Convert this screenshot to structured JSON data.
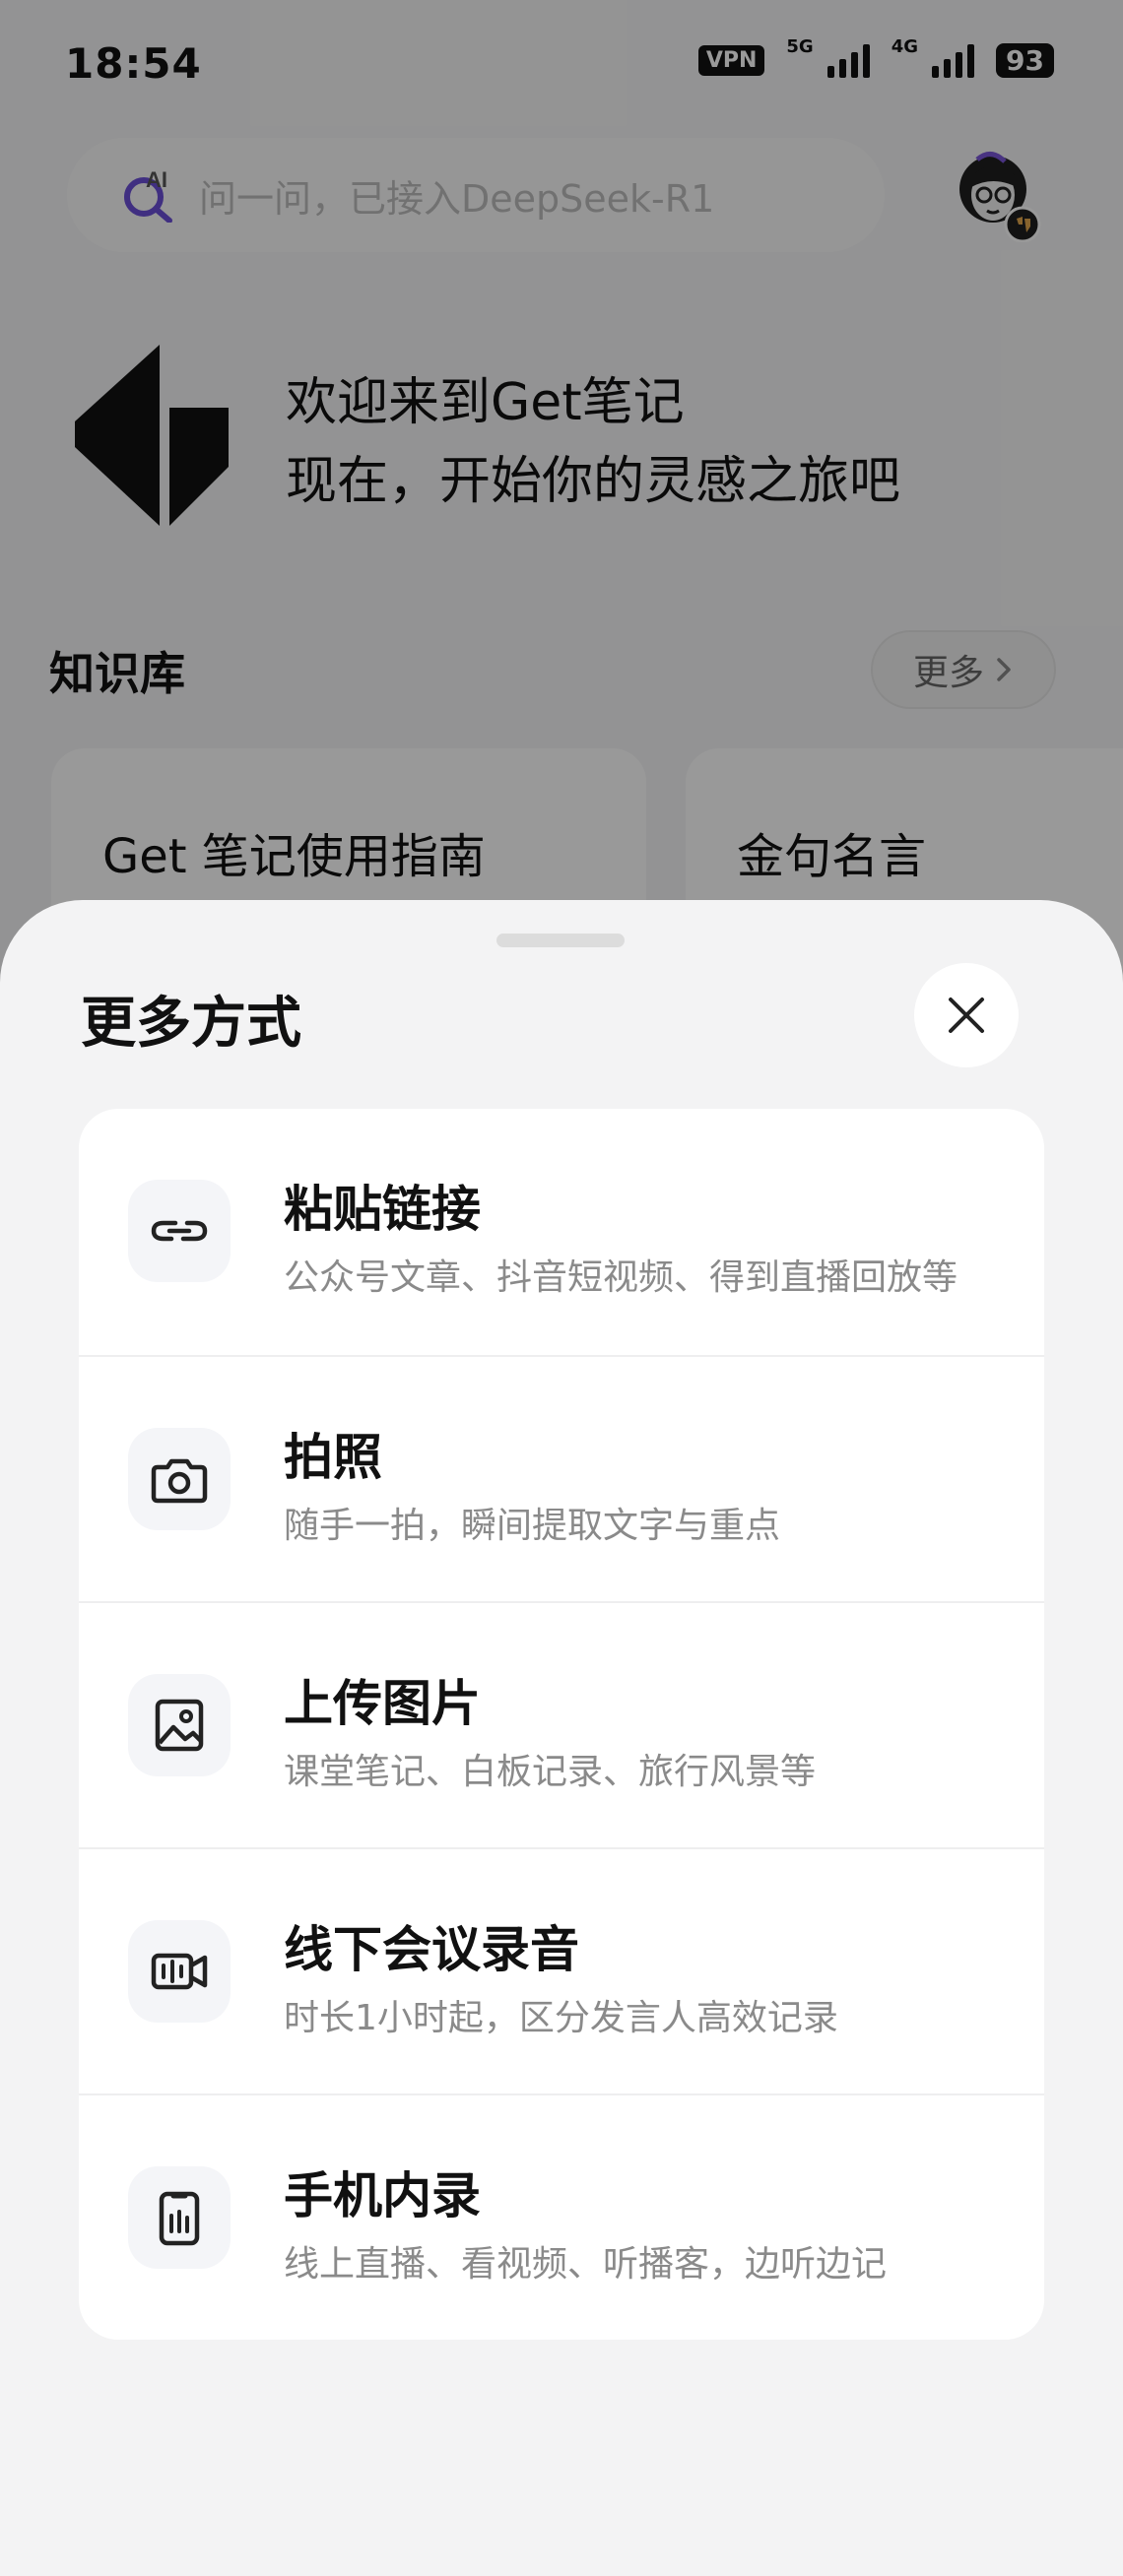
{
  "status_bar": {
    "time": "18:54",
    "vpn": "VPN",
    "network_1": "5G",
    "network_2": "4G",
    "battery": "93"
  },
  "search": {
    "placeholder": "问一问，已接入DeepSeek-R1"
  },
  "welcome": {
    "line1": "欢迎来到Get笔记",
    "line2": "现在，开始你的灵感之旅吧"
  },
  "knowledge_base": {
    "title": "知识库",
    "more_label": "更多",
    "cards": [
      {
        "title": "Get 笔记使用指南"
      },
      {
        "title": "金句名言"
      }
    ]
  },
  "sheet": {
    "title": "更多方式",
    "options": [
      {
        "title": "粘贴链接",
        "desc": "公众号文章、抖音短视频、得到直播回放等",
        "icon": "link-icon"
      },
      {
        "title": "拍照",
        "desc": "随手一拍，瞬间提取文字与重点",
        "icon": "camera-icon"
      },
      {
        "title": "上传图片",
        "desc": "课堂笔记、白板记录、旅行风景等",
        "icon": "image-icon"
      },
      {
        "title": "线下会议录音",
        "desc": "时长1小时起，区分发言人高效记录",
        "icon": "video-record-icon"
      },
      {
        "title": "手机内录",
        "desc": "线上直播、看视频、听播客，边听边记",
        "icon": "phone-record-icon"
      }
    ]
  },
  "colors": {
    "accent_purple": "#6b4fd8",
    "overlay": "rgba(0,0,0,0.40)",
    "sheet_bg": "#f3f3f4"
  }
}
